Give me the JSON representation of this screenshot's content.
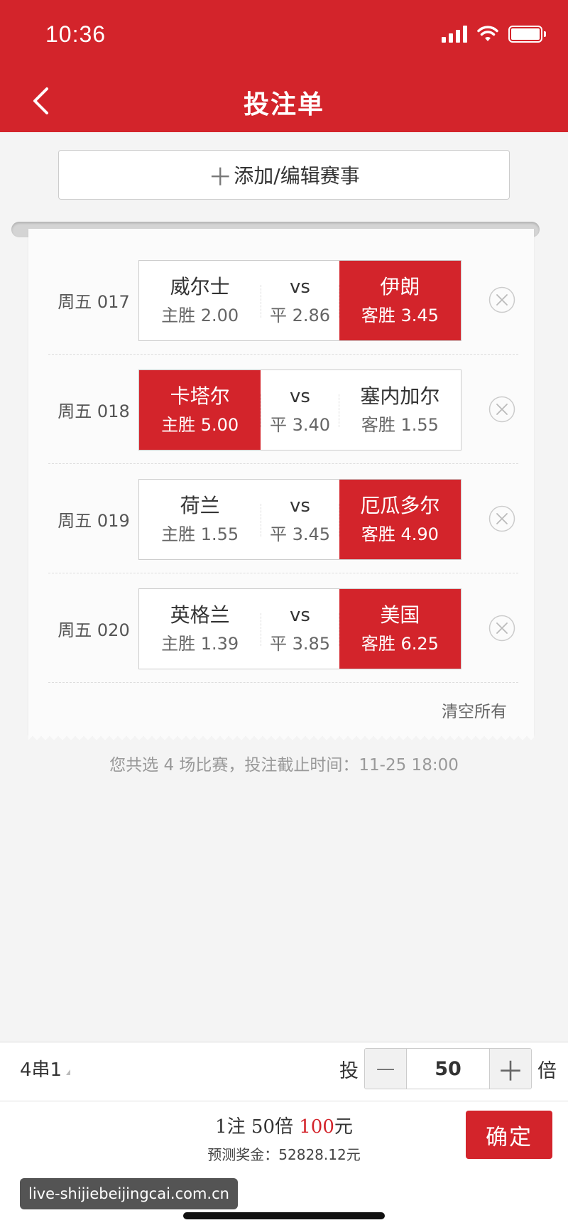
{
  "status_bar": {
    "time": "10:36"
  },
  "header": {
    "title": "投注单",
    "back_icon": "chevron-left-icon"
  },
  "add_button": {
    "plus": "＋",
    "label": "添加/编辑赛事"
  },
  "matches": [
    {
      "no": "周五 017",
      "home_team": "威尔士",
      "home_odds": "主胜 2.00",
      "vs": "vs",
      "draw_odds": "平 2.86",
      "away_team": "伊朗",
      "away_odds": "客胜 3.45",
      "selected": "away"
    },
    {
      "no": "周五 018",
      "home_team": "卡塔尔",
      "home_odds": "主胜 5.00",
      "vs": "vs",
      "draw_odds": "平 3.40",
      "away_team": "塞内加尔",
      "away_odds": "客胜 1.55",
      "selected": "home"
    },
    {
      "no": "周五 019",
      "home_team": "荷兰",
      "home_odds": "主胜 1.55",
      "vs": "vs",
      "draw_odds": "平 3.45",
      "away_team": "厄瓜多尔",
      "away_odds": "客胜 4.90",
      "selected": "away"
    },
    {
      "no": "周五 020",
      "home_team": "英格兰",
      "home_odds": "主胜 1.39",
      "vs": "vs",
      "draw_odds": "平 3.85",
      "away_team": "美国",
      "away_odds": "客胜 6.25",
      "selected": "away"
    }
  ],
  "clear_all": "清空所有",
  "deadline": "您共选 4 场比赛，投注截止时间：11-25 18:00",
  "bottom": {
    "combo": "4串1",
    "bet_label": "投",
    "minus": "−",
    "multiple": "50",
    "plus": "＋",
    "times_label": "倍",
    "summary_prefix": "1注 50倍 ",
    "summary_amount": "100",
    "summary_suffix": "元",
    "prize_text": "预测奖金：52828.12元",
    "confirm": "确定"
  },
  "watermark": "live-shijiebeijingcai.com.cn",
  "colors": {
    "brand_red": "#d3242b",
    "background": "#f4f4f4"
  }
}
